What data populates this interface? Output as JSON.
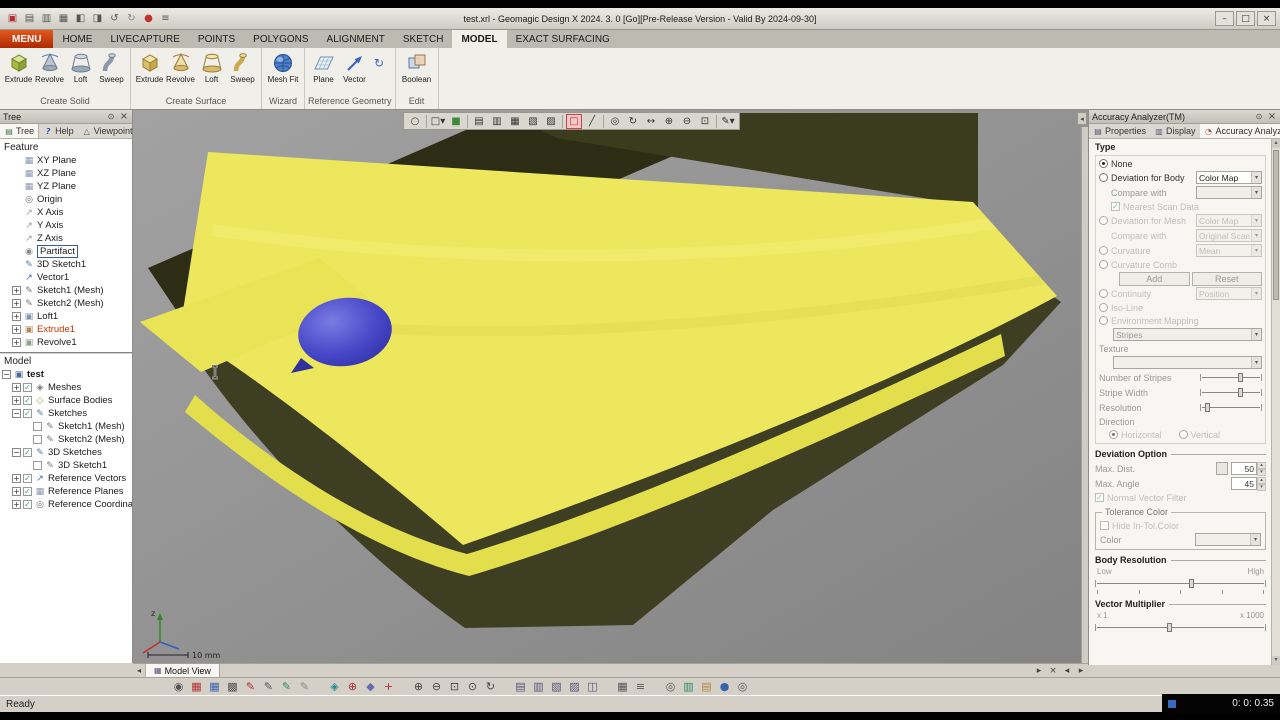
{
  "colors": {
    "menu_tab_red": "#ac2a00",
    "model_yellow": "#ece75c",
    "model_dark_olive": "#33331a",
    "blob_blue": "#4646c8",
    "active_tool_red": "#cc2222",
    "feature_alert_red": "#cc3300"
  },
  "title_bar": {
    "title": "test.xrl - Geomagic Design X 2024. 3. 0 [Go][Pre-Release Version - Valid By 2024-09-30]",
    "icons": [
      {
        "name": "app-icon",
        "glyph": "▣",
        "color": "#b03030"
      },
      {
        "name": "new-file-icon",
        "glyph": "▤",
        "color": "#555555"
      },
      {
        "name": "open-file-icon",
        "glyph": "▥",
        "color": "#555555"
      },
      {
        "name": "save-icon",
        "glyph": "▦",
        "color": "#555555"
      },
      {
        "name": "import-icon",
        "glyph": "◧",
        "color": "#555555"
      },
      {
        "name": "export-icon",
        "glyph": "◨",
        "color": "#555555"
      },
      {
        "name": "undo-icon",
        "glyph": "↺",
        "color": "#555555"
      },
      {
        "name": "redo-icon",
        "glyph": "↻",
        "color": "#888888"
      },
      {
        "name": "record-icon",
        "glyph": "●",
        "color": "#c03030"
      },
      {
        "name": "quick-menu-icon",
        "glyph": "≡",
        "color": "#555555"
      }
    ]
  },
  "tab_bar": {
    "menu": "MENU",
    "tabs": [
      "HOME",
      "LIVECAPTURE",
      "POINTS",
      "POLYGONS",
      "ALIGNMENT",
      "SKETCH",
      "MODEL",
      "EXACT SURFACING"
    ],
    "selected": "MODEL"
  },
  "ribbon": {
    "create_solid": {
      "name": "Create Solid",
      "buttons": [
        "Extrude",
        "Revolve",
        "Loft",
        "Sweep"
      ]
    },
    "create_surface": {
      "name": "Create Surface",
      "buttons": [
        "Extrude",
        "Revolve",
        "Loft",
        "Sweep"
      ]
    },
    "wizard": {
      "name": "Wizard",
      "buttons": [
        "Mesh Fit"
      ]
    },
    "reference_geometry": {
      "name": "Reference Geometry",
      "buttons": [
        "Plane",
        "Vector"
      ]
    },
    "edit": {
      "name": "Edit",
      "buttons": [
        "Boolean"
      ]
    }
  },
  "tree": {
    "header": "Tree",
    "tabs": [
      "Tree",
      "Help",
      "Viewpoint"
    ],
    "feature_label": "Feature",
    "feature_items": [
      {
        "label": "XY Plane",
        "icon": "plane-icon",
        "glyph": "▦",
        "ic": "#8a97b0",
        "indent": 1
      },
      {
        "label": "XZ Plane",
        "icon": "plane-icon",
        "glyph": "▦",
        "ic": "#8a97b0",
        "indent": 1
      },
      {
        "label": "YZ Plane",
        "icon": "plane-icon",
        "glyph": "▦",
        "ic": "#8a97b0",
        "indent": 1
      },
      {
        "label": "Origin",
        "icon": "origin-icon",
        "glyph": "◎",
        "ic": "#666666",
        "indent": 1
      },
      {
        "label": "X Axis",
        "icon": "axis-icon",
        "glyph": "↗",
        "ic": "#999999",
        "indent": 1
      },
      {
        "label": "Y Axis",
        "icon": "axis-icon",
        "glyph": "↗",
        "ic": "#999999",
        "indent": 1
      },
      {
        "label": "Z Axis",
        "icon": "axis-icon",
        "glyph": "↗",
        "ic": "#999999",
        "indent": 1
      },
      {
        "label": "Partifact",
        "icon": "body-icon",
        "glyph": "◉",
        "ic": "#8a8a8a",
        "indent": 1,
        "boxed": true
      },
      {
        "label": "3D Sketch1",
        "icon": "sketch3d-icon",
        "glyph": "✎",
        "ic": "#4a7ab0",
        "indent": 1
      },
      {
        "label": "Vector1",
        "icon": "vector-icon",
        "glyph": "↗",
        "ic": "#3a6ac0",
        "indent": 1
      },
      {
        "label": "Sketch1 (Mesh)",
        "icon": "sketch-icon",
        "glyph": "✎",
        "ic": "#777777",
        "indent": 1,
        "expand": "+"
      },
      {
        "label": "Sketch2 (Mesh)",
        "icon": "sketch-icon",
        "glyph": "✎",
        "ic": "#777777",
        "indent": 1,
        "expand": "+"
      },
      {
        "label": "Loft1",
        "icon": "loft-icon",
        "glyph": "▣",
        "ic": "#7f95a8",
        "indent": 1,
        "expand": "+"
      },
      {
        "label": "Extrude1",
        "icon": "extrude-icon",
        "glyph": "▣",
        "ic": "#b08a5a",
        "indent": 1,
        "expand": "+",
        "lc": "#cc3300"
      },
      {
        "label": "Revolve1",
        "icon": "revolve-icon",
        "glyph": "▣",
        "ic": "#8aa08a",
        "indent": 1,
        "expand": "+"
      }
    ],
    "model_label": "Model",
    "model_items": [
      {
        "label": "test",
        "icon": "model-root-icon",
        "glyph": "▣",
        "ic": "#4a6a9a",
        "indent": 0,
        "expand": "-",
        "bold": true
      },
      {
        "label": "Meshes",
        "icon": "meshes-icon",
        "glyph": "◈",
        "ic": "#777777",
        "indent": 1,
        "expand": "+",
        "cb": true,
        "checked": true
      },
      {
        "label": "Surface Bodies",
        "icon": "surface-bodies-icon",
        "glyph": "◇",
        "ic": "#b8923a",
        "indent": 1,
        "expand": "+",
        "cb": true,
        "checked": true
      },
      {
        "label": "Sketches",
        "icon": "sketches-icon",
        "glyph": "✎",
        "ic": "#4a7ab0",
        "indent": 1,
        "expand": "-",
        "cb": true,
        "checked": true
      },
      {
        "label": "Sketch1 (Mesh)",
        "icon": "sketch-icon",
        "glyph": "✎",
        "ic": "#777777",
        "indent": 2,
        "cb": true,
        "checked": false
      },
      {
        "label": "Sketch2 (Mesh)",
        "icon": "sketch-icon",
        "glyph": "✎",
        "ic": "#777777",
        "indent": 2,
        "cb": true,
        "checked": false
      },
      {
        "label": "3D Sketches",
        "icon": "sketches3d-icon",
        "glyph": "✎",
        "ic": "#4a7ab0",
        "indent": 1,
        "expand": "-",
        "cb": true,
        "checked": true
      },
      {
        "label": "3D Sketch1",
        "icon": "sketch3d-icon",
        "glyph": "✎",
        "ic": "#777777",
        "indent": 2,
        "cb": true,
        "checked": false
      },
      {
        "label": "Reference Vectors",
        "icon": "ref-vectors-icon",
        "glyph": "↗",
        "ic": "#3a6ac0",
        "indent": 1,
        "expand": "+",
        "cb": true,
        "checked": true
      },
      {
        "label": "Reference Planes",
        "icon": "ref-planes-icon",
        "glyph": "▦",
        "ic": "#8a97b0",
        "indent": 1,
        "expand": "+",
        "cb": true,
        "checked": true
      },
      {
        "label": "Reference Coordinates",
        "icon": "ref-coords-icon",
        "glyph": "◎",
        "ic": "#666666",
        "indent": 1,
        "expand": "+",
        "cb": true,
        "checked": true
      }
    ]
  },
  "viewport": {
    "view_tab": "Model View",
    "scale_label": "10 mm",
    "axis_z": "z",
    "toolbar_icons": [
      {
        "name": "select-ellipse-icon",
        "glyph": "○"
      },
      {
        "name": "sep"
      },
      {
        "name": "view-mode-icon",
        "glyph": "□▾"
      },
      {
        "name": "shade-mode-icon",
        "glyph": "■",
        "color": "#3d8a3d"
      },
      {
        "name": "sep"
      },
      {
        "name": "clip-plane-icon",
        "glyph": "▤"
      },
      {
        "name": "section-view-icon",
        "glyph": "▥"
      },
      {
        "name": "mesh-display-icon",
        "glyph": "▦"
      },
      {
        "name": "wireframe-icon",
        "glyph": "▧"
      },
      {
        "name": "shaded-edges-icon",
        "glyph": "▨"
      },
      {
        "name": "sep"
      },
      {
        "name": "region-select-icon",
        "glyph": "□",
        "active": true,
        "color": "#cc2222"
      },
      {
        "name": "polyline-icon",
        "glyph": "╱"
      },
      {
        "name": "sep"
      },
      {
        "name": "snap-icon",
        "glyph": "◎"
      },
      {
        "name": "orbit-icon",
        "glyph": "↻"
      },
      {
        "name": "pan-icon",
        "glyph": "↔"
      },
      {
        "name": "zoom-in-icon",
        "glyph": "⊕"
      },
      {
        "name": "zoom-out-icon",
        "glyph": "⊖"
      },
      {
        "name": "zoom-fit-icon",
        "glyph": "⊡"
      },
      {
        "name": "sep"
      },
      {
        "name": "annotate-icon",
        "glyph": "✎▾"
      }
    ],
    "tab_icons": [
      {
        "name": "play-view-icon",
        "glyph": "▸"
      },
      {
        "name": "close-view-icon",
        "glyph": "×"
      },
      {
        "name": "scroll-left-icon",
        "glyph": "◂"
      },
      {
        "name": "scroll-right-icon",
        "glyph": "▸"
      }
    ]
  },
  "analyzer": {
    "header": "Accuracy Analyzer(TM)",
    "tabs": [
      "Properties",
      "Display",
      "Accuracy Analyzer(TM)"
    ],
    "type_label": "Type",
    "none_label": "None",
    "dev_body_label": "Deviation for Body",
    "dev_body_value": "Color Map",
    "compare_with_label": "Compare with",
    "compare_body_value": "",
    "nearest_label": "Nearest Scan Data",
    "dev_mesh_label": "Deviation for Mesh",
    "dev_mesh_value": "Color Map",
    "compare_mesh_value": "Original Scan Data",
    "curvature_label": "Curvature",
    "curvature_value": "Mean",
    "curvature_comb_label": "Curvature Comb",
    "add_label": "Add",
    "reset_label": "Reset",
    "continuity_label": "Continuity",
    "continuity_value": "Position",
    "isoline_label": "Iso-Line",
    "env_label": "Environment Mapping",
    "env_value": "Stripes",
    "texture_label": "Texture",
    "texture_value": "",
    "num_stripes_label": "Number of Stripes",
    "stripe_width_label": "Stripe Width",
    "resolution_label": "Resolution",
    "direction_label": "Direction",
    "horizontal_label": "Horizontal",
    "vertical_label": "Vertical",
    "deviation_option_label": "Deviation Option",
    "max_dist_label": "Max. Dist.",
    "max_dist_value": "50",
    "max_angle_label": "Max. Angle",
    "max_angle_value": "45",
    "normal_filter_label": "Normal Vector Filter",
    "tolerance_label": "Tolerance Color",
    "hide_tol_label": "Hide In-Tol.Color",
    "color_label": "Color",
    "body_res_label": "Body Resolution",
    "low_label": "Low",
    "high_label": "High",
    "vector_mult_label": "Vector Multiplier",
    "x1_label": "x 1",
    "x1000_label": "x 1000"
  },
  "bottom": {
    "ready": "Ready",
    "timer": "0: 0: 0.35",
    "toolbar_icons": [
      {
        "name": "screen-capture-icon",
        "glyph": "◉",
        "color": "#555555"
      },
      {
        "name": "point-cloud-red-icon",
        "glyph": "▦",
        "color": "#b03030"
      },
      {
        "name": "point-cloud-blue-icon",
        "glyph": "▦",
        "color": "#3a62b0"
      },
      {
        "name": "mesh-grid-icon",
        "glyph": "▩",
        "color": "#555555"
      },
      {
        "name": "edit-red-pencil-icon",
        "glyph": "✎",
        "color": "#b03030"
      },
      {
        "name": "edit-pencil-icon",
        "glyph": "✎",
        "color": "#555555"
      },
      {
        "name": "edit-add-icon",
        "glyph": "✎",
        "color": "#2a8a5a"
      },
      {
        "name": "edit-remove-icon",
        "glyph": "✎",
        "color": "#888888"
      },
      {
        "name": "gap"
      },
      {
        "name": "fill-holes-icon",
        "glyph": "◈",
        "color": "#2a8a8a"
      },
      {
        "name": "defeature-icon",
        "glyph": "⊕",
        "color": "#b03030"
      },
      {
        "name": "smooth-icon",
        "glyph": "◆",
        "color": "#6a6ab0"
      },
      {
        "name": "optimize-icon",
        "glyph": "+",
        "color": "#b03030"
      },
      {
        "name": "gap"
      },
      {
        "name": "zoom-in-tool-icon",
        "glyph": "⊕",
        "color": "#444444"
      },
      {
        "name": "zoom-out-tool-icon",
        "glyph": "⊖",
        "color": "#444444"
      },
      {
        "name": "zoom-window-icon",
        "glyph": "⊡",
        "color": "#444444"
      },
      {
        "name": "zoom-fit-tool-icon",
        "glyph": "⊙",
        "color": "#444444"
      },
      {
        "name": "view-rotate-icon",
        "glyph": "↻",
        "color": "#444444"
      },
      {
        "name": "gap"
      },
      {
        "name": "plane-tool-icon",
        "glyph": "▤",
        "color": "#555577"
      },
      {
        "name": "plane-check-icon",
        "glyph": "▥",
        "color": "#555577"
      },
      {
        "name": "plane-edit-icon",
        "glyph": "▧",
        "color": "#555577"
      },
      {
        "name": "plane-add-icon",
        "glyph": "▨",
        "color": "#555577"
      },
      {
        "name": "coord-tool-icon",
        "glyph": "◫",
        "color": "#555577"
      },
      {
        "name": "gap"
      },
      {
        "name": "table-icon",
        "glyph": "▦",
        "color": "#555555"
      },
      {
        "name": "list-icon",
        "glyph": "≡",
        "color": "#555555"
      },
      {
        "name": "gap"
      },
      {
        "name": "measure-icon",
        "glyph": "◎",
        "color": "#555555"
      },
      {
        "name": "chart-icon",
        "glyph": "▥",
        "color": "#2a8a5a"
      },
      {
        "name": "report-icon",
        "glyph": "▤",
        "color": "#b08a3a"
      },
      {
        "name": "user-icon",
        "glyph": "●",
        "color": "#3a62b0"
      },
      {
        "name": "settings-icon",
        "glyph": "◎",
        "color": "#555555"
      }
    ]
  }
}
